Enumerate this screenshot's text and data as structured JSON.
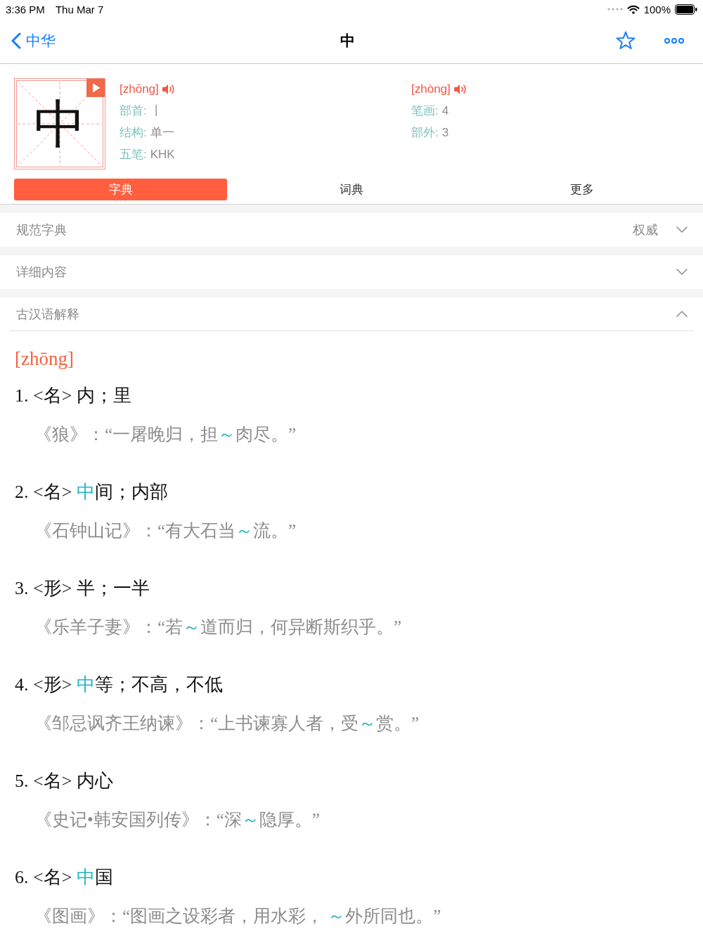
{
  "status_bar": {
    "time": "3:36 PM",
    "date": "Thu Mar 7",
    "battery": "100%"
  },
  "nav": {
    "back": "中华",
    "title": "中"
  },
  "character": {
    "glyph": "中",
    "info_columns": [
      {
        "pinyin": "[zhōng]",
        "fields": [
          {
            "label": "部首:",
            "value": "丨"
          },
          {
            "label": "结构:",
            "value": "单一"
          },
          {
            "label": "五笔:",
            "value": "KHK"
          }
        ]
      },
      {
        "pinyin": "[zhòng]",
        "fields": [
          {
            "label": "笔画:",
            "value": "4"
          },
          {
            "label": "部外:",
            "value": "3"
          }
        ]
      }
    ]
  },
  "tabs": [
    {
      "label": "字典",
      "selected": true
    },
    {
      "label": "词典",
      "selected": false
    },
    {
      "label": "更多",
      "selected": false
    }
  ],
  "sections": [
    {
      "title": "规范字典",
      "tag": "权威",
      "expanded": false
    },
    {
      "title": "详细内容",
      "expanded": false
    },
    {
      "title": "古汉语解释",
      "expanded": true,
      "content": {
        "pinyin": "[zhōng]",
        "definitions": [
          {
            "sense": [
              {
                "text": "1. <名> 内；里",
                "highlight": false
              }
            ],
            "example": [
              {
                "text": "《狼》：“一屠晚归，担",
                "highlight": false
              },
              {
                "text": "～",
                "highlight": true
              },
              {
                "text": "肉尽。”",
                "highlight": false
              }
            ]
          },
          {
            "sense": [
              {
                "text": "2. <名> ",
                "highlight": false
              },
              {
                "text": "中",
                "highlight": true
              },
              {
                "text": "间；内部",
                "highlight": false
              }
            ],
            "example": [
              {
                "text": "《石钟山记》：“有大石当",
                "highlight": false
              },
              {
                "text": "～",
                "highlight": true
              },
              {
                "text": "流。”",
                "highlight": false
              }
            ]
          },
          {
            "sense": [
              {
                "text": "3. <形> 半；一半",
                "highlight": false
              }
            ],
            "example": [
              {
                "text": "《乐羊子妻》：“若",
                "highlight": false
              },
              {
                "text": "～",
                "highlight": true
              },
              {
                "text": "道而归，何异断斯织乎。”",
                "highlight": false
              }
            ]
          },
          {
            "sense": [
              {
                "text": "4. <形> ",
                "highlight": false
              },
              {
                "text": "中",
                "highlight": true
              },
              {
                "text": "等；不高，不低",
                "highlight": false
              }
            ],
            "example": [
              {
                "text": "《邹忌讽齐王纳谏》：“上书谏寡人者，受",
                "highlight": false
              },
              {
                "text": "～",
                "highlight": true
              },
              {
                "text": "赏。”",
                "highlight": false
              }
            ]
          },
          {
            "sense": [
              {
                "text": "5. <名> 内心",
                "highlight": false
              }
            ],
            "example": [
              {
                "text": "《史记•韩安国列传》：“深",
                "highlight": false
              },
              {
                "text": "～",
                "highlight": true
              },
              {
                "text": "隐厚。”",
                "highlight": false
              }
            ]
          },
          {
            "sense": [
              {
                "text": "6. <名> ",
                "highlight": false
              },
              {
                "text": "中",
                "highlight": true
              },
              {
                "text": "国",
                "highlight": false
              }
            ],
            "example": [
              {
                "text": "《图画》：“图画之设彩者，用水彩， ",
                "highlight": false
              },
              {
                "text": "～",
                "highlight": true
              },
              {
                "text": "外所同也。”",
                "highlight": false
              }
            ]
          }
        ]
      }
    }
  ]
}
